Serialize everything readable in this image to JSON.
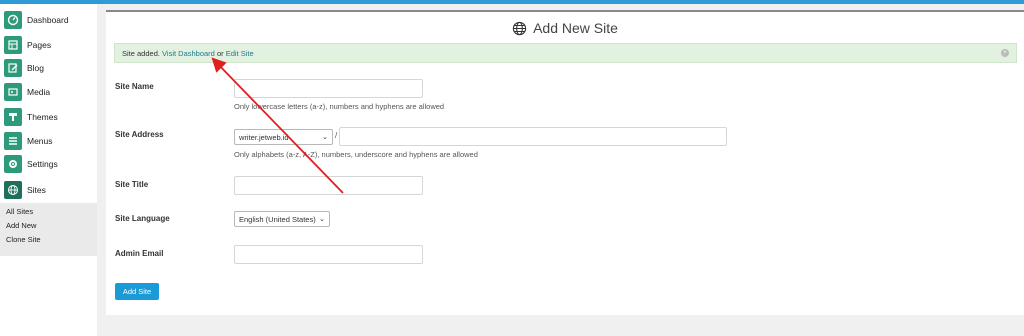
{
  "sidebar": {
    "items": [
      {
        "label": "Dashboard",
        "icon": "dashboard-icon"
      },
      {
        "label": "Pages",
        "icon": "pages-icon"
      },
      {
        "label": "Blog",
        "icon": "blog-icon"
      },
      {
        "label": "Media",
        "icon": "media-icon"
      },
      {
        "label": "Themes",
        "icon": "themes-icon"
      },
      {
        "label": "Menus",
        "icon": "menus-icon"
      },
      {
        "label": "Settings",
        "icon": "settings-icon"
      },
      {
        "label": "Sites",
        "icon": "globe-icon"
      }
    ],
    "submenu": [
      "All Sites",
      "Add New",
      "Clone Site"
    ]
  },
  "page": {
    "title": "Add New Site"
  },
  "notice": {
    "prefix": "Site added.",
    "link1": "Visit Dashboard",
    "middle": "or",
    "link2": "Edit Site"
  },
  "form": {
    "site_name_label": "Site Name",
    "site_name_hint": "Only lowercase letters (a-z), numbers and hyphens are allowed",
    "site_address_label": "Site Address",
    "site_address_domain": "writer.jetweb.id",
    "site_address_separator": "/",
    "site_address_hint": "Only alphabets (a-z, A-Z), numbers, underscore and hyphens are allowed",
    "site_title_label": "Site Title",
    "site_language_label": "Site Language",
    "site_language_value": "English (United States)",
    "admin_email_label": "Admin Email",
    "submit_label": "Add Site"
  },
  "colors": {
    "accent": "#2e9bd6",
    "sidebar_icon": "#2e9a7c",
    "button": "#1a9ad6",
    "notice_bg": "#e3f1e0",
    "arrow": "#e02020"
  }
}
